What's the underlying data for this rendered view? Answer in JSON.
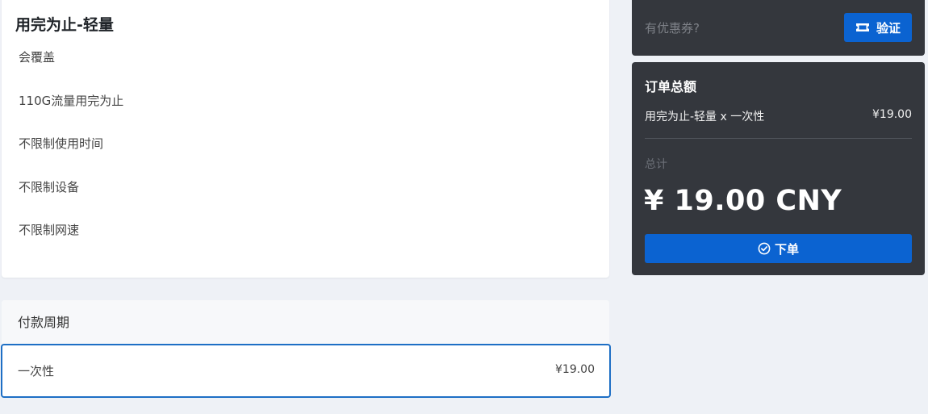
{
  "plan": {
    "title": "用完为止-轻量",
    "features": [
      "会覆盖",
      "110G流量用完为止",
      "不限制使用时间",
      "不限制设备",
      "不限制网速"
    ]
  },
  "period": {
    "header": "付款周期",
    "options": [
      {
        "name": "一次性",
        "price": "¥19.00",
        "selected": true
      }
    ]
  },
  "coupon": {
    "placeholder": "有优惠券?",
    "verify_label": "验证"
  },
  "order": {
    "title": "订单总额",
    "item_label": "用完为止-轻量 x 一次性",
    "item_price": "¥19.00",
    "total_label": "总计",
    "total_amount": "¥ 19.00 CNY",
    "checkout_label": "下单"
  },
  "colors": {
    "accent": "#0b63d1",
    "panel_dark": "#34373d",
    "page_bg": "#eef1f6",
    "selected_border": "#1e6fc5"
  },
  "icons": {
    "verify": "ticket-icon",
    "checkout": "check-circle-icon"
  }
}
